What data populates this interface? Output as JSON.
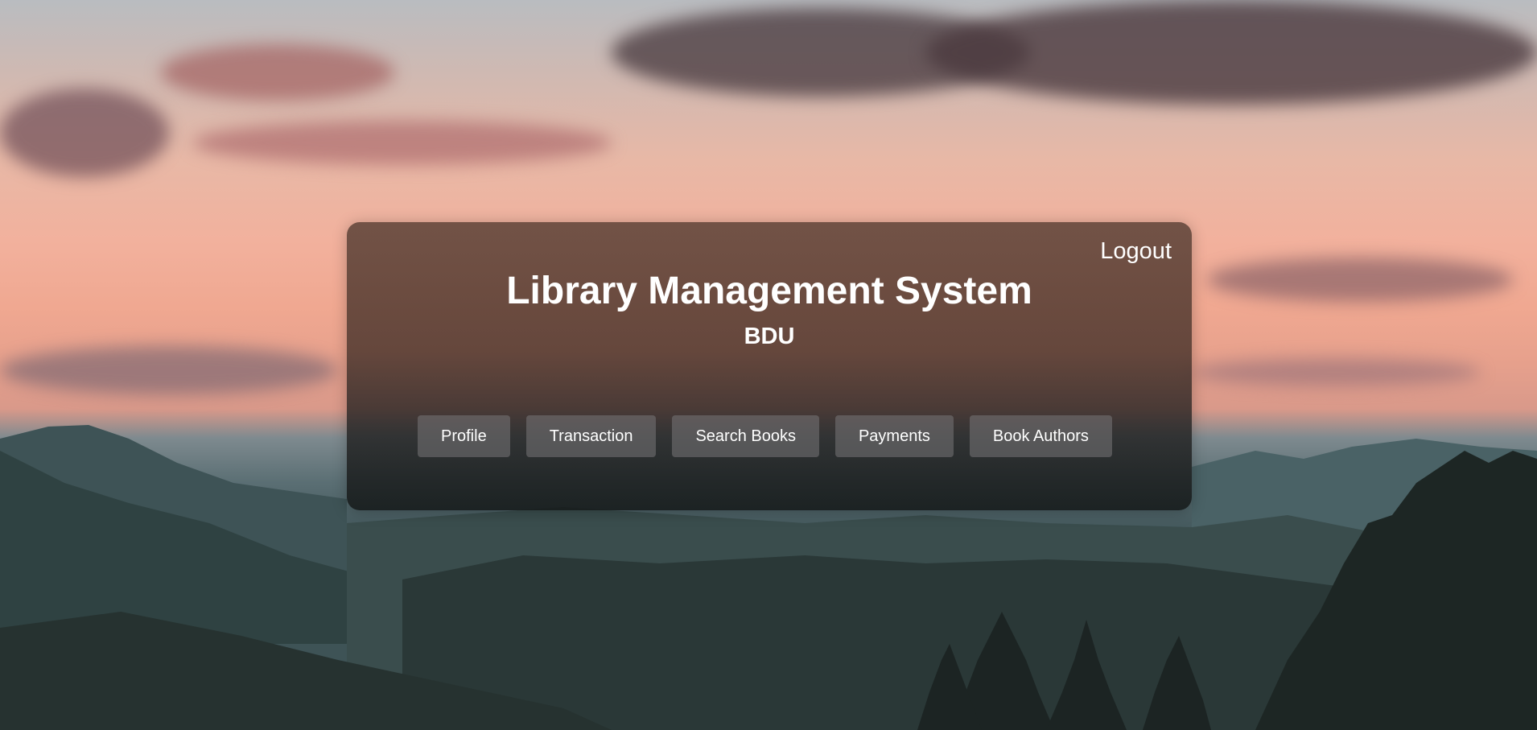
{
  "header": {
    "logout_label": "Logout",
    "title": "Library Management System",
    "subtitle": "BDU"
  },
  "nav": {
    "items": [
      {
        "label": "Profile"
      },
      {
        "label": "Transaction"
      },
      {
        "label": "Search Books"
      },
      {
        "label": "Payments"
      },
      {
        "label": "Book Authors"
      }
    ]
  },
  "colors": {
    "panel": "#4e372d",
    "button": "#787678",
    "text": "#ffffff"
  }
}
